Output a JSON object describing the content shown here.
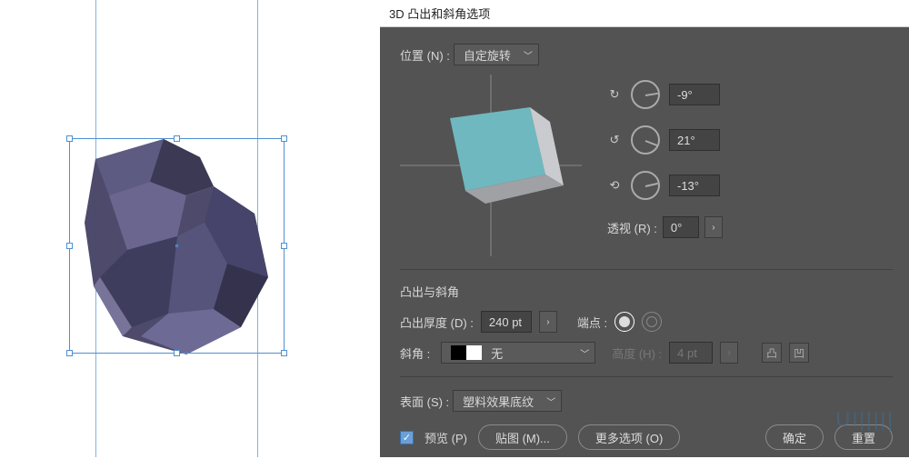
{
  "dialog": {
    "title": "3D 凸出和斜角选项",
    "position": {
      "label": "位置 (N) :",
      "value": "自定旋转"
    },
    "rotation": {
      "x": "-9°",
      "y": "21°",
      "z": "-13°"
    },
    "perspective": {
      "label": "透视 (R) :",
      "value": "0°"
    },
    "extrude_bevel": {
      "title": "凸出与斜角",
      "depth_label": "凸出厚度 (D) :",
      "depth_value": "240 pt",
      "cap_label": "端点 :",
      "bevel_label": "斜角 :",
      "bevel_value": "无",
      "height_label": "高度 (H) :",
      "height_value": "4 pt"
    },
    "surface": {
      "label": "表面 (S) :",
      "value": "塑料效果底纹"
    },
    "footer": {
      "preview": "预览 (P)",
      "map": "贴图 (M)...",
      "more": "更多选项 (O)",
      "ok": "确定",
      "reset": "重置"
    }
  }
}
